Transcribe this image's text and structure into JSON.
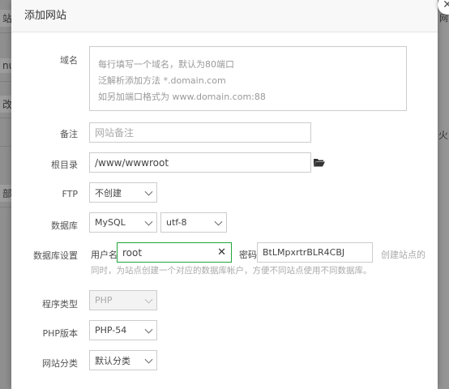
{
  "background": {
    "frag_top": "站",
    "frag_right_top": "网",
    "frag_left_1": "nu",
    "frag_left_2": "改",
    "frag_left_3": "部",
    "frag_right_mid": "火"
  },
  "modal": {
    "title": "添加网站",
    "close_icon": "close-icon"
  },
  "form": {
    "domain": {
      "label": "域名",
      "placeholder_lines": [
        "每行填写一个域名，默认为80端口",
        "泛解析添加方法 *.domain.com",
        "如另加端口格式为 www.domain.com:88"
      ]
    },
    "remark": {
      "label": "备注",
      "placeholder": "网站备注"
    },
    "root": {
      "label": "根目录",
      "value": "/www/wwwroot"
    },
    "ftp": {
      "label": "FTP",
      "selected": "不创建"
    },
    "database": {
      "label": "数据库",
      "type": "MySQL",
      "charset": "utf-8"
    },
    "db_settings": {
      "label": "数据库设置",
      "user_label": "用户名",
      "user_value": "root",
      "password_label": "密码",
      "password_value": "BtLMpxrtrBLR4CBJ",
      "hint_line1": "创建站点的",
      "hint_line2": "同时，为站点创建一个对应的数据库帐户，方便不同站点使用不同数据库。"
    },
    "program_type": {
      "label": "程序类型",
      "selected": "PHP"
    },
    "php_version": {
      "label": "PHP版本",
      "selected": "PHP-54"
    },
    "site_category": {
      "label": "网站分类",
      "selected": "默认分类"
    }
  }
}
